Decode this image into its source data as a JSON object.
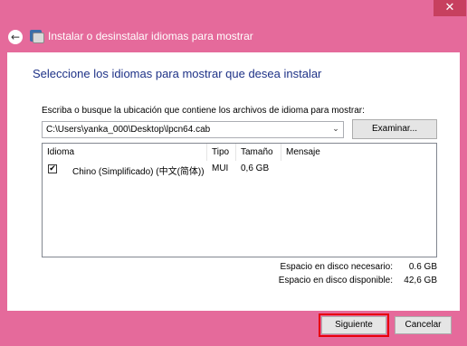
{
  "window": {
    "title": "Instalar o desinstalar idiomas para mostrar",
    "close_glyph": "✕",
    "back_glyph": "←",
    "accent": "#e56a9b"
  },
  "page": {
    "heading": "Seleccione los idiomas para mostrar que desea instalar"
  },
  "path": {
    "label": "Escriba o busque la ubicación que contiene los archivos de idioma para mostrar:",
    "value": "C:\\Users\\yanka_000\\Desktop\\lpcn64.cab",
    "dropdown_glyph": "⌄",
    "browse_label": "Examinar..."
  },
  "table": {
    "columns": [
      "Idioma",
      "Tipo",
      "Tamaño",
      "Mensaje"
    ],
    "rows": [
      {
        "checked": true,
        "check_glyph": "✔",
        "language": "Chino (Simplificado) (中文(简体))",
        "type": "MUI",
        "size": "0,6 GB",
        "message": ""
      }
    ]
  },
  "disk": {
    "required_label": "Espacio en disco necesario:",
    "required_value": "0.6 GB",
    "available_label": "Espacio en disco disponible:",
    "available_value": "42,6 GB"
  },
  "footer": {
    "next_label": "Siguiente",
    "cancel_label": "Cancelar",
    "highlight_color": "#e8000b"
  }
}
